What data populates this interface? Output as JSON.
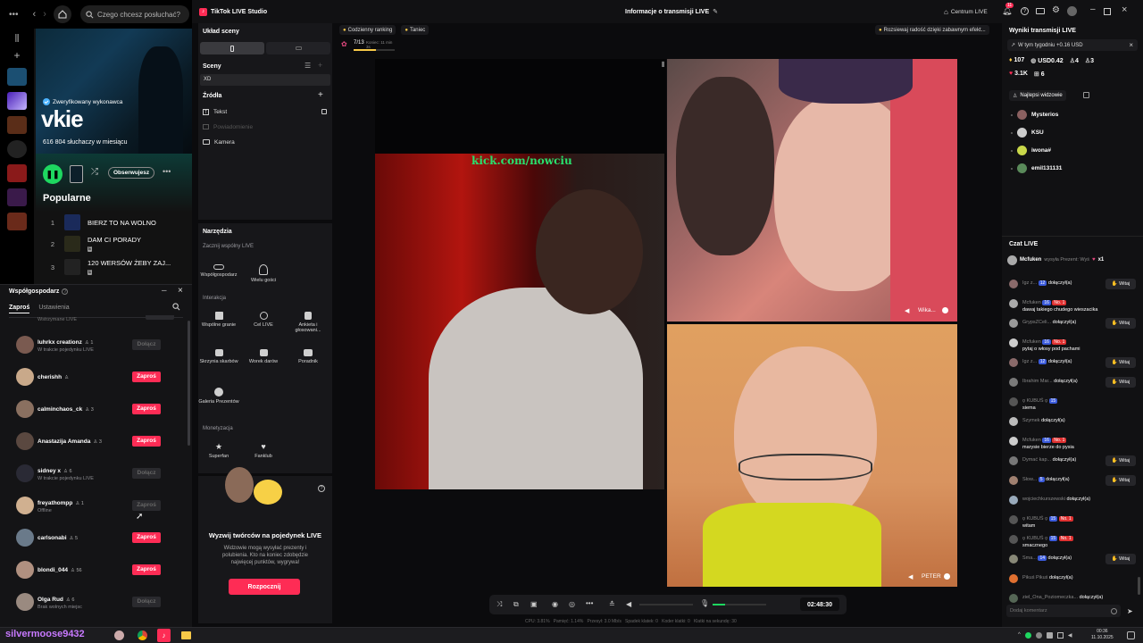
{
  "spotify": {
    "search_placeholder": "Czego chcesz posłuchać?",
    "verified": "Zweryfikowany wykonawca",
    "artist": "vkie",
    "listeners": "616 804 słuchaczy w miesiącu",
    "follow": "Obserwujesz",
    "popular": "Popularne",
    "tracks": [
      {
        "num": "1",
        "title": "BIERZ TO NA WOLNO"
      },
      {
        "num": "2",
        "title": "DAM CI PORADY"
      },
      {
        "num": "3",
        "title": "120 WERSÓW ŻEBY ZAJ..."
      }
    ],
    "explicit": "E"
  },
  "cohost": {
    "title": "Współgospodarz",
    "tab_invite": "Zaproś",
    "tab_settings": "Ustawienia",
    "top_cut": "Wstrzymane LIVE",
    "invite_label": "Zaproś",
    "join_label": "Dołącz",
    "rows": [
      {
        "name": "luhrkx creationz",
        "badge": "1",
        "sub": "W trakcie pojedynku LIVE",
        "btn": "Dołącz",
        "active": false
      },
      {
        "name": "cherishh",
        "badge": "",
        "sub": "",
        "btn": "Zaproś",
        "active": true
      },
      {
        "name": "calminchaos_ck",
        "badge": "3",
        "sub": "",
        "btn": "Zaproś",
        "active": true
      },
      {
        "name": "Anastazija Amanda",
        "badge": "3",
        "sub": "",
        "btn": "Zaproś",
        "active": true
      },
      {
        "name": "sidney x",
        "badge": "6",
        "sub": "W trakcie pojedynku LIVE",
        "btn": "Dołącz",
        "active": false
      },
      {
        "name": "freyathompp",
        "badge": "1",
        "sub": "Offline",
        "btn": "Zaproś",
        "active": false
      },
      {
        "name": "carlsonabi",
        "badge": "5",
        "sub": "",
        "btn": "Zaproś",
        "active": true
      },
      {
        "name": "blondi_044",
        "badge": "56",
        "sub": "",
        "btn": "Zaproś",
        "active": true
      },
      {
        "name": "Olga Rud",
        "badge": "6",
        "sub": "Brak wolnych miejsc",
        "btn": "Dołącz",
        "active": false
      }
    ]
  },
  "titlebar": {
    "app": "TikTok LIVE Studio",
    "center": "Informacje o transmisji LIVE",
    "centrum": "Centrum LIVE",
    "notif_count": "11"
  },
  "studio": {
    "layout": "Układ sceny",
    "scenes": "Sceny",
    "scene_name": "XD",
    "sources": "Źródła",
    "src_text": "Tekst",
    "src_notice": "Powiadomienie",
    "src_camera": "Kamera"
  },
  "tools": {
    "title": "Narzędzia",
    "cohost_section": "Zacznij wspólny LIVE",
    "cohost_btn": "Współgospodarz",
    "multi_btn": "Wielu gości",
    "interaction": "Interakcja",
    "game": "Wspólne granie",
    "goal": "Cel LIVE",
    "poll": "Ankieta i głosowani...",
    "treasure": "Skrzynia skarbów",
    "wishes": "Worek darów",
    "guide": "Poradnik",
    "gallery": "Galeria Prezentów",
    "monet": "Monetyzacja",
    "superfan": "Superfan",
    "fanclub": "Fanklub"
  },
  "challenge": {
    "title": "Wyzwij twórców na pojedynek LIVE",
    "desc": "Widzowie mogą wysyłać prezenty i polubienia. Kto na koniec zdobędzie najwięcej punktów, wygrywa!",
    "start": "Rozpocznij"
  },
  "preview": {
    "chip1": "Codzienny ranking",
    "chip2": "Taniec",
    "chip_right": "Rozsiewaj radość dzięki zabawnym efekt...",
    "goal_count": "7/13",
    "goal_timer": "Koniec: 11 min 3s",
    "overlay_url": "kick.com/nowciu",
    "guest1": "Wika...",
    "guest2": "PETER",
    "timer": "02:48:30",
    "stats": "CPU: 3.81%   Pamięć: 1.14%   Przesył: 3.0 Mb/s   Spadek klatek: 0   Koder klatki: 0   Klatki na sekundę: 30"
  },
  "right": {
    "results": "Wyniki transmisji LIVE",
    "week": "W tym tygodniu +0.16 USD",
    "s1": "107",
    "s2": "USD0.42",
    "s3": "4",
    "s4": "3",
    "s5": "3.1K",
    "s6": "6",
    "top_viewers": "Najlepsi widzowie",
    "viewers": [
      "Mysterios",
      "KSU",
      "iwona#",
      "emil131131"
    ],
    "chat_title": "Czat LIVE",
    "pinned_user": "Mcfuken",
    "pinned_text": "wysyła Prezent: Wyś",
    "pinned_mult": "x1",
    "wave": "Witaj",
    "joined": "dołączył(a)",
    "input": "Dodaj komentarz"
  },
  "chat": [
    {
      "user": "Igz z...",
      "lvl": "12",
      "text": "dołączył(a)",
      "wave": true
    },
    {
      "user": "Mcfuken",
      "lvl": "16",
      "no1": "No. 1",
      "text": "dawaj takiego chudego wieszacika",
      "wave": false
    },
    {
      "user": "GrypsZCeli...",
      "lvl": "",
      "text": "dołączył(a)",
      "wave": true
    },
    {
      "user": "Mcfuken",
      "lvl": "16",
      "no1": "No. 1",
      "text": "pytaj o włosy pod pachami",
      "wave": false
    },
    {
      "user": "Igz z...",
      "lvl": "12",
      "text": "dołączył(a)",
      "wave": true
    },
    {
      "user": "Ibrahim Mar...",
      "lvl": "",
      "text": "dołączył(a)",
      "wave": true
    },
    {
      "user": "ǫ KUBUŚ ǫ",
      "lvl": "15",
      "text": "siema",
      "wave": false
    },
    {
      "user": "Szymek",
      "lvl": "",
      "text": "dołączył(a)",
      "wave": false
    },
    {
      "user": "Mcfuken",
      "lvl": "16",
      "no1": "No. 1",
      "text": "marysie bierze do pysia",
      "wave": false
    },
    {
      "user": "Dymać kap...",
      "lvl": "",
      "text": "dołączył(a)",
      "wave": true
    },
    {
      "user": "Słow...",
      "lvl": "5",
      "text": "dołączył(a)",
      "wave": true
    },
    {
      "user": "wojciechkurszewski",
      "lvl": "",
      "text": "dołączył(a)",
      "wave": false
    },
    {
      "user": "ǫ KUBUŚ ǫ",
      "lvl": "15",
      "no1": "No. 1",
      "text": "witam",
      "wave": false
    },
    {
      "user": "ǫ KUBUŚ ǫ",
      "lvl": "15",
      "no1": "No. 1",
      "text": "smacznego",
      "wave": false
    },
    {
      "user": "Sma...",
      "lvl": "14",
      "text": "dołączył(a)",
      "wave": true
    },
    {
      "user": "Pikuś Pikuś",
      "lvl": "",
      "text": "dołączył(a)",
      "wave": false
    },
    {
      "user": "ziel_Ona_Poziomeczka...",
      "lvl": "",
      "text": "dołączył(a)",
      "wave": false
    }
  ],
  "taskbar": {
    "user": "silvermoose9432",
    "time": "00:36",
    "date": "11.10.2025"
  },
  "colors": {
    "accent": "#fe2c55",
    "spotify_green": "#1ed760",
    "level_blue": "#3b5bdb"
  }
}
